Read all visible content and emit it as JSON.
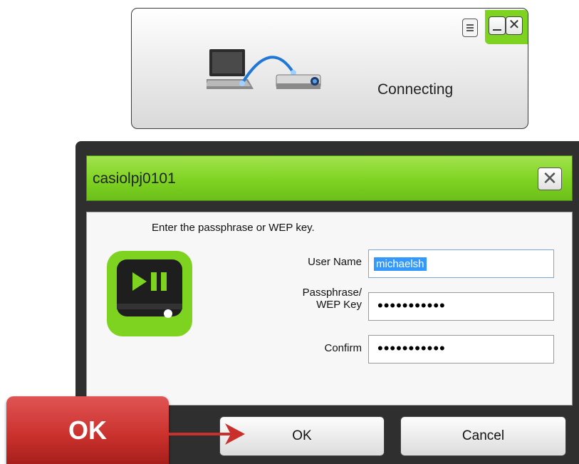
{
  "connection_window": {
    "status": "Connecting",
    "menu_icon": "menu-icon",
    "minimize_icon": "minimize-icon",
    "close_icon": "close-icon",
    "accent_color": "#7ed321"
  },
  "dialog": {
    "title": "casiolpj0101",
    "close_glyph": "✕",
    "prompt": "Enter the passphrase or WEP key.",
    "app_icon": "play-pause-icon",
    "fields": {
      "user_name": {
        "label": "User Name",
        "value": "michaelsh"
      },
      "passphrase": {
        "label_line1": "Passphrase/",
        "label_line2": "WEP Key",
        "value": "•••••••••••"
      },
      "confirm": {
        "label": "Confirm",
        "value": "•••••••••••"
      }
    },
    "buttons": {
      "ok": "OK",
      "cancel": "Cancel"
    },
    "title_color": "#7ed321"
  },
  "annotation": {
    "label": "OK",
    "color": "#c9302c"
  }
}
